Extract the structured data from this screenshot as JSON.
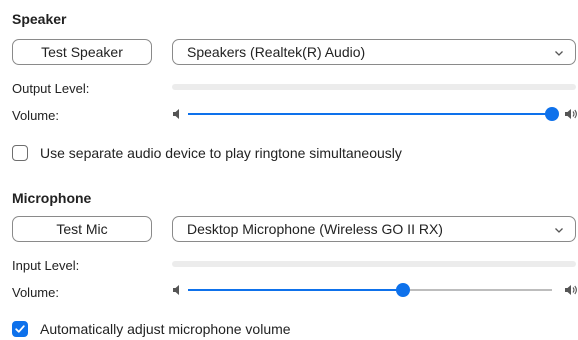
{
  "speaker": {
    "title": "Speaker",
    "test_button": "Test Speaker",
    "device": "Speakers (Realtek(R) Audio)",
    "output_level_label": "Output Level:",
    "output_level": 0,
    "volume_label": "Volume:",
    "volume": 1.0
  },
  "ringtone": {
    "label": "Use separate audio device to play ringtone simultaneously",
    "checked": false
  },
  "microphone": {
    "title": "Microphone",
    "test_button": "Test Mic",
    "device": "Desktop Microphone (Wireless GO II RX)",
    "input_level_label": "Input Level:",
    "input_level": 0,
    "volume_label": "Volume:",
    "volume": 0.59
  },
  "auto_adjust": {
    "label": "Automatically adjust microphone volume",
    "checked": true
  },
  "colors": {
    "accent": "#0e71eb",
    "track": "#bdbdbd",
    "level_bg": "#ececec"
  },
  "icons": {
    "dropdown": "chevron-down-icon",
    "volume_low": "speaker-low-icon",
    "volume_high": "speaker-high-icon",
    "check": "checkmark-icon"
  }
}
